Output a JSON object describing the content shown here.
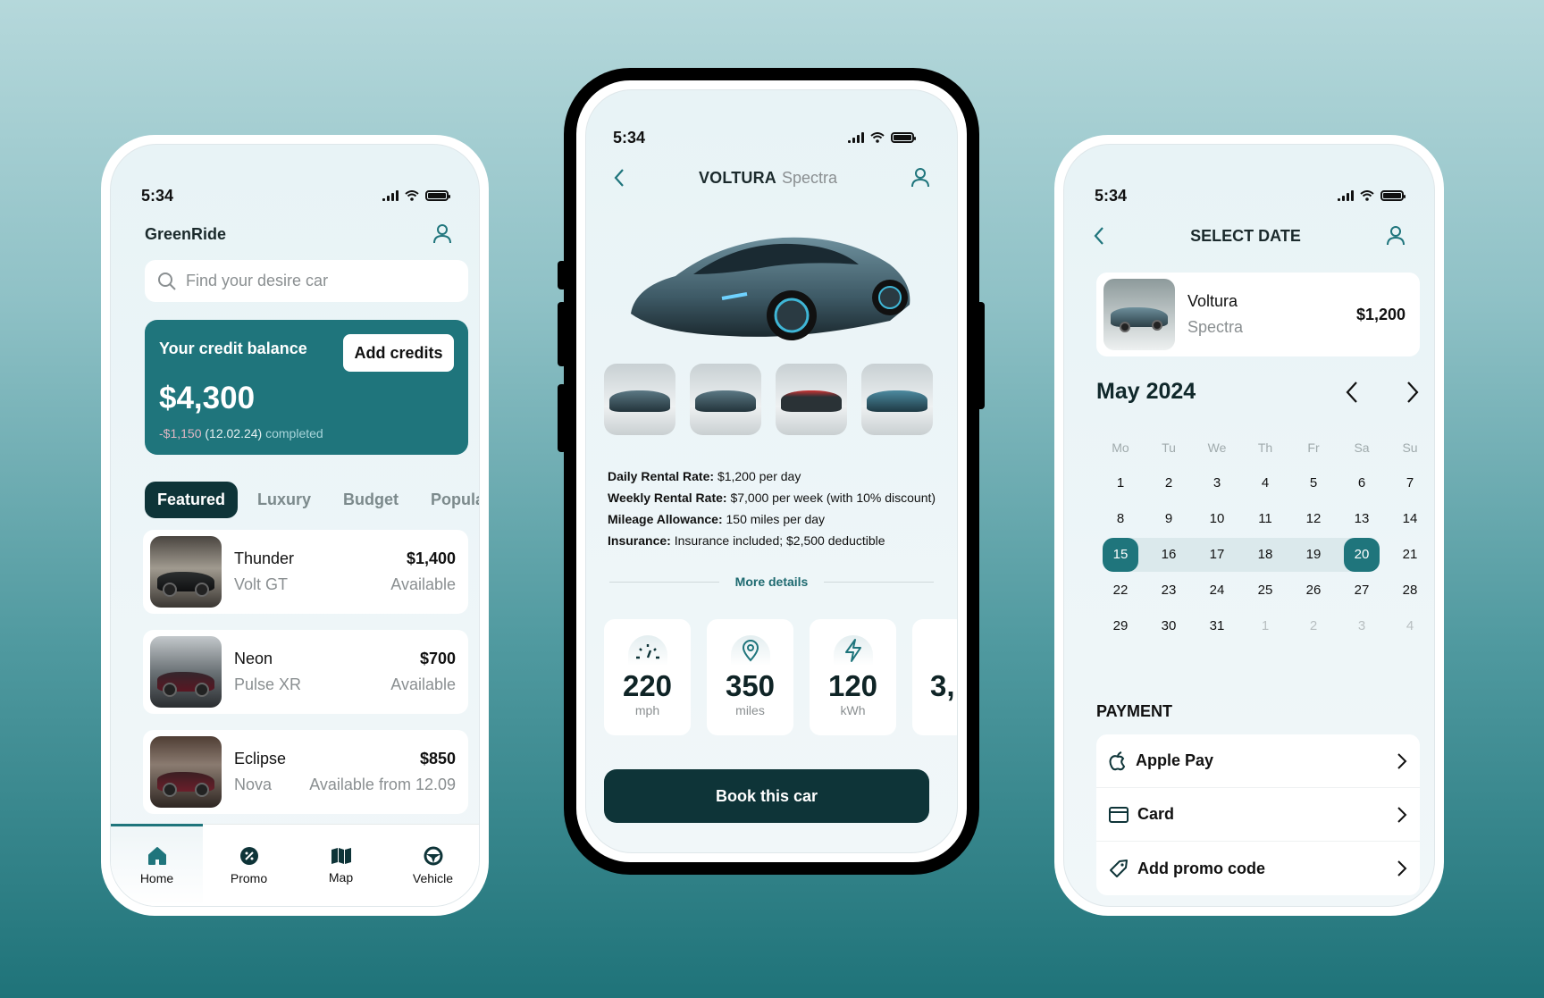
{
  "status_bar": {
    "time": "5:34"
  },
  "home": {
    "brand": "GreenRide",
    "search": {
      "placeholder": "Find your desire car",
      "value": ""
    },
    "credit": {
      "label": "Your credit balance",
      "add_button": "Add credits",
      "balance": "$4,300",
      "last_tx_amount": "-$1,150",
      "last_tx_date": "(12.02.24)",
      "last_tx_status": "completed"
    },
    "tabs": [
      {
        "label": "Featured",
        "active": true
      },
      {
        "label": "Luxury",
        "active": false
      },
      {
        "label": "Budget",
        "active": false
      },
      {
        "label": "Popular",
        "active": false
      }
    ],
    "cars": [
      {
        "name": "Thunder",
        "model": "Volt GT",
        "price": "$1,400",
        "availability": "Available"
      },
      {
        "name": "Neon",
        "model": "Pulse XR",
        "price": "$700",
        "availability": "Available"
      },
      {
        "name": "Eclipse",
        "model": "Nova",
        "price": "$850",
        "availability": "Available from 12.09"
      }
    ],
    "nav": [
      {
        "label": "Home",
        "icon": "home-icon",
        "active": true
      },
      {
        "label": "Promo",
        "icon": "promo-badge-icon",
        "active": false
      },
      {
        "label": "Map",
        "icon": "map-icon",
        "active": false
      },
      {
        "label": "Vehicle",
        "icon": "steering-wheel-icon",
        "active": false
      }
    ]
  },
  "detail": {
    "brand": "VOLTURA",
    "model": "Spectra",
    "gallery_count": 4,
    "specs": [
      {
        "label": "Daily Rental Rate:",
        "value": "$1,200 per day"
      },
      {
        "label": "Weekly Rental Rate:",
        "value": "$7,000 per week (with 10% discount)"
      },
      {
        "label": "Mileage Allowance:",
        "value": "150 miles per day"
      },
      {
        "label": "Insurance:",
        "value": "Insurance included; $2,500 deductible"
      }
    ],
    "more_details": "More details",
    "stats": [
      {
        "value": "220",
        "unit": "mph",
        "icon": "speedometer-icon"
      },
      {
        "value": "350",
        "unit": "miles",
        "icon": "location-pin-icon"
      },
      {
        "value": "120",
        "unit": "kWh",
        "icon": "lightning-icon"
      },
      {
        "value": "3,",
        "unit": "",
        "icon": ""
      }
    ],
    "book_button": "Book this car"
  },
  "select_date": {
    "title": "SELECT DATE",
    "car": {
      "name": "Voltura",
      "model": "Spectra",
      "price": "$1,200"
    },
    "month": "May 2024",
    "weekdays": [
      "Mo",
      "Tu",
      "We",
      "Th",
      "Fr",
      "Sa",
      "Su"
    ],
    "weeks": [
      [
        "1",
        "2",
        "3",
        "4",
        "5",
        "6",
        "7"
      ],
      [
        "8",
        "9",
        "10",
        "11",
        "12",
        "13",
        "14"
      ],
      [
        "15",
        "16",
        "17",
        "18",
        "19",
        "20",
        "21"
      ],
      [
        "22",
        "23",
        "24",
        "25",
        "26",
        "27",
        "28"
      ],
      [
        "29",
        "30",
        "31",
        "1",
        "2",
        "3",
        "4"
      ]
    ],
    "range_start": "15",
    "range_end": "20",
    "payment_title": "PAYMENT",
    "payment_methods": [
      {
        "label": "Apple Pay",
        "icon": "apple-icon"
      },
      {
        "label": "Card",
        "icon": "credit-card-icon"
      },
      {
        "label": "Add promo code",
        "icon": "tag-icon"
      }
    ]
  },
  "colors": {
    "accent": "#1f757c",
    "dark": "#0e3438",
    "background_top": "#b5d8db",
    "background_bottom": "#1f7379"
  }
}
